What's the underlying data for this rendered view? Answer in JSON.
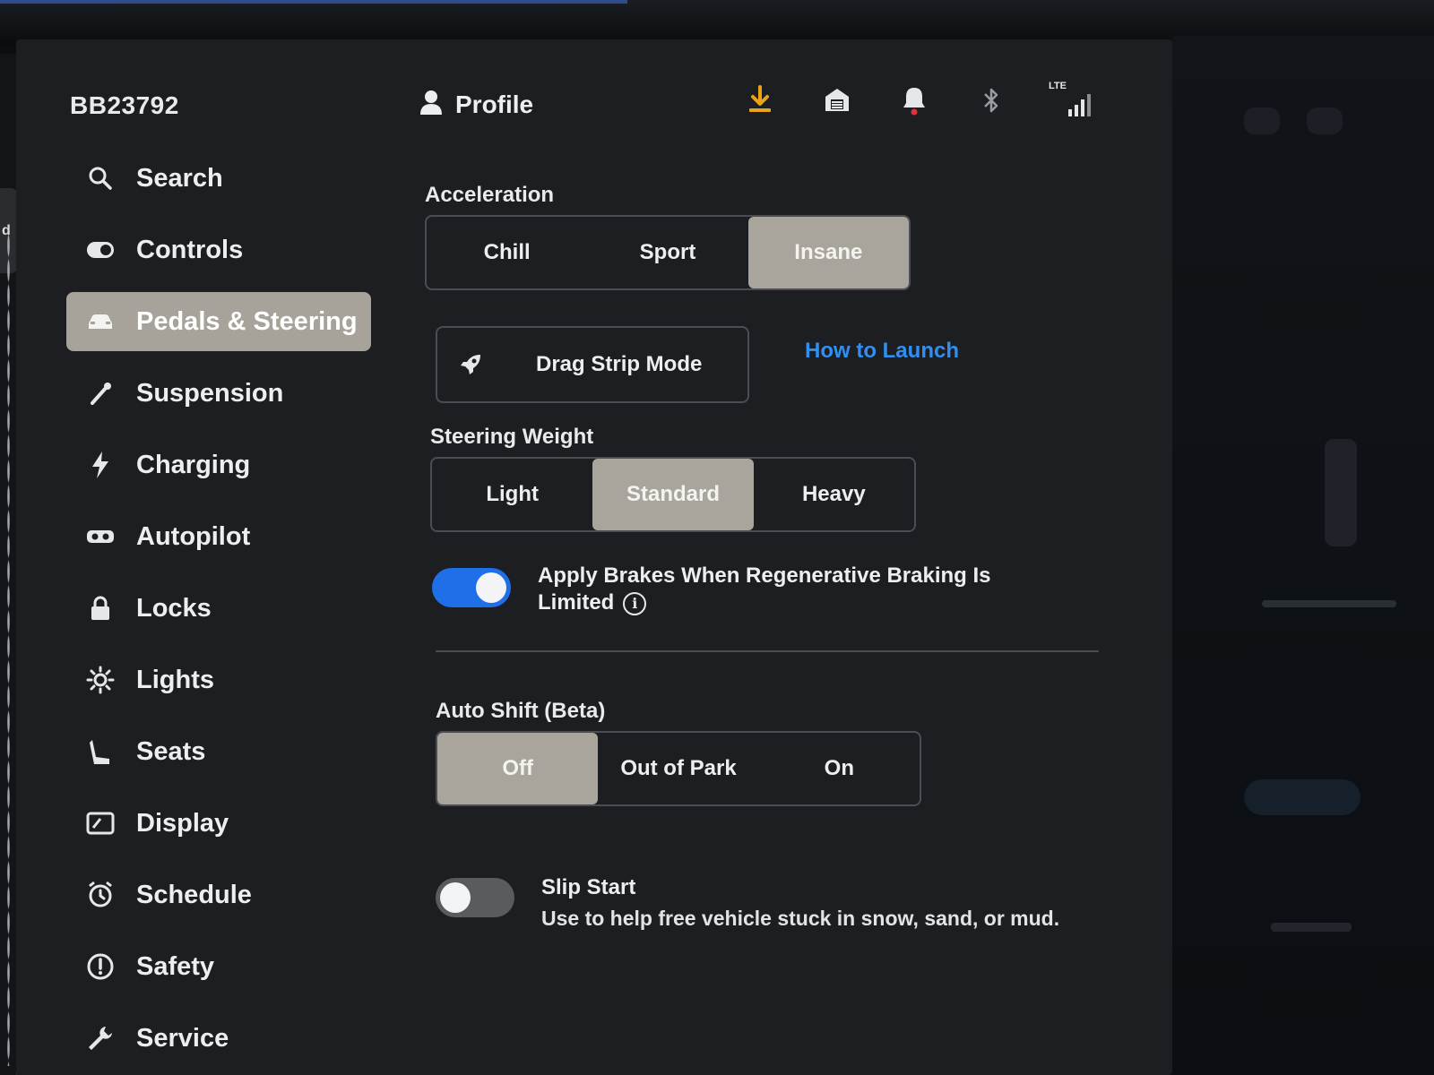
{
  "vehicle_name": "BB23792",
  "left_strip_tab": "d",
  "header": {
    "profile_label": "Profile",
    "status_icons": [
      "download-icon",
      "garage-icon",
      "bell-icon",
      "bluetooth-icon",
      "lte-signal-icon"
    ],
    "lte_label": "LTE",
    "accent_color": "#e8a317",
    "alert_dot_color": "#e0323a"
  },
  "sidebar": {
    "items": [
      {
        "label": "Search",
        "icon": "search-icon"
      },
      {
        "label": "Controls",
        "icon": "toggle-icon"
      },
      {
        "label": "Pedals & Steering",
        "icon": "car-icon",
        "active": true
      },
      {
        "label": "Suspension",
        "icon": "wrench-suspension-icon"
      },
      {
        "label": "Charging",
        "icon": "lightning-icon"
      },
      {
        "label": "Autopilot",
        "icon": "steering-wheel-icon"
      },
      {
        "label": "Locks",
        "icon": "lock-icon"
      },
      {
        "label": "Lights",
        "icon": "sun-icon"
      },
      {
        "label": "Seats",
        "icon": "seat-icon"
      },
      {
        "label": "Display",
        "icon": "display-icon"
      },
      {
        "label": "Schedule",
        "icon": "alarm-clock-icon"
      },
      {
        "label": "Safety",
        "icon": "alert-circle-icon"
      },
      {
        "label": "Service",
        "icon": "wrench-icon"
      }
    ]
  },
  "acceleration": {
    "label": "Acceleration",
    "options": [
      "Chill",
      "Sport",
      "Insane"
    ],
    "selected": "Insane"
  },
  "drag_strip": {
    "label": "Drag Strip Mode",
    "icon": "rocket-icon",
    "link_label": "How to Launch"
  },
  "steering_weight": {
    "label": "Steering Weight",
    "options": [
      "Light",
      "Standard",
      "Heavy"
    ],
    "selected": "Standard"
  },
  "regen_toggle": {
    "label": "Apply Brakes When Regenerative Braking Is Limited",
    "state": "on"
  },
  "auto_shift": {
    "label": "Auto Shift (Beta)",
    "options": [
      "Off",
      "Out of Park",
      "On"
    ],
    "selected": "Off"
  },
  "slip_start": {
    "label": "Slip Start",
    "description": "Use to help free vehicle stuck in snow, sand, or mud.",
    "state": "off"
  },
  "colors": {
    "selected_segment": "#a9a59d",
    "toggle_on": "#1f6fe8",
    "link": "#2f8ff3",
    "background": "#1d1e21"
  }
}
